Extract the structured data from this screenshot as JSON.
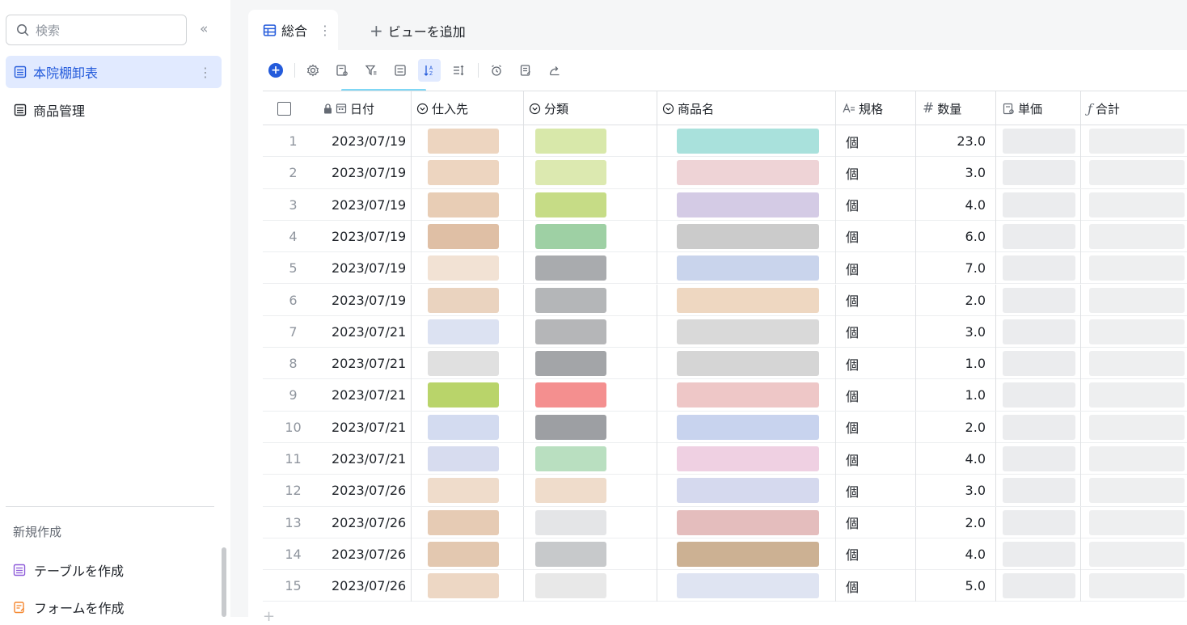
{
  "sidebar": {
    "search_placeholder": "検索",
    "items": [
      {
        "label": "本院棚卸表",
        "active": true
      },
      {
        "label": "商品管理",
        "active": false
      }
    ],
    "new_section_label": "新規作成",
    "create_items": [
      {
        "label": "テーブルを作成",
        "color": "#8e5bd9"
      },
      {
        "label": "フォームを作成",
        "color": "#f5872f"
      }
    ]
  },
  "tabs": {
    "active_label": "総合",
    "add_view_label": "ビューを追加"
  },
  "table": {
    "columns": [
      "日付",
      "仕入先",
      "分類",
      "商品名",
      "規格",
      "数量",
      "単価",
      "合計"
    ],
    "rows": [
      {
        "n": "1",
        "date": "2023/07/19",
        "unit": "個",
        "qty": "23.0"
      },
      {
        "n": "2",
        "date": "2023/07/19",
        "unit": "個",
        "qty": "3.0"
      },
      {
        "n": "3",
        "date": "2023/07/19",
        "unit": "個",
        "qty": "4.0"
      },
      {
        "n": "4",
        "date": "2023/07/19",
        "unit": "個",
        "qty": "6.0"
      },
      {
        "n": "5",
        "date": "2023/07/19",
        "unit": "個",
        "qty": "7.0"
      },
      {
        "n": "6",
        "date": "2023/07/19",
        "unit": "個",
        "qty": "2.0"
      },
      {
        "n": "7",
        "date": "2023/07/21",
        "unit": "個",
        "qty": "3.0"
      },
      {
        "n": "8",
        "date": "2023/07/21",
        "unit": "個",
        "qty": "1.0"
      },
      {
        "n": "9",
        "date": "2023/07/21",
        "unit": "個",
        "qty": "1.0"
      },
      {
        "n": "10",
        "date": "2023/07/21",
        "unit": "個",
        "qty": "2.0"
      },
      {
        "n": "11",
        "date": "2023/07/21",
        "unit": "個",
        "qty": "4.0"
      },
      {
        "n": "12",
        "date": "2023/07/26",
        "unit": "個",
        "qty": "3.0"
      },
      {
        "n": "13",
        "date": "2023/07/26",
        "unit": "個",
        "qty": "2.0"
      },
      {
        "n": "14",
        "date": "2023/07/26",
        "unit": "個",
        "qty": "4.0"
      },
      {
        "n": "15",
        "date": "2023/07/26",
        "unit": "個",
        "qty": "5.0"
      }
    ]
  },
  "colors": {
    "accent": "#245bdb",
    "active_bg": "#e1eaff",
    "redacted_supplier": [
      "#edd5c0",
      "#edd5c0",
      "#e8cdb5",
      "#dfbfa5",
      "#f2e2d4",
      "#ead3bf",
      "#dce2f2",
      "#e0e0e0",
      "#b9d46a",
      "#d3dbf0",
      "#d7dcef",
      "#efdccb",
      "#e6cbb4",
      "#e3c8b0",
      "#edd7c4"
    ],
    "redacted_category": [
      "#d8e8aa",
      "#dce9b0",
      "#c6dc86",
      "#9ed0a4",
      "#a9abae",
      "#b4b6b8",
      "#b5b6b8",
      "#a3a5a8",
      "#f48f8f",
      "#9d9fa3",
      "#b9dfc0",
      "#efdccb",
      "#e4e5e7",
      "#c7c9cb",
      "#e8e8e8"
    ],
    "redacted_product": [
      "#a9e1dc",
      "#eed3d6",
      "#d4cbe5",
      "#cbcbcb",
      "#c9d4ec",
      "#eed7c1",
      "#d9d9d9",
      "#d5d5d5",
      "#eec7c7",
      "#c8d3ee",
      "#efd0e2",
      "#d5d9ee",
      "#e4bdbd",
      "#ccb193",
      "#dfe4f2"
    ]
  }
}
